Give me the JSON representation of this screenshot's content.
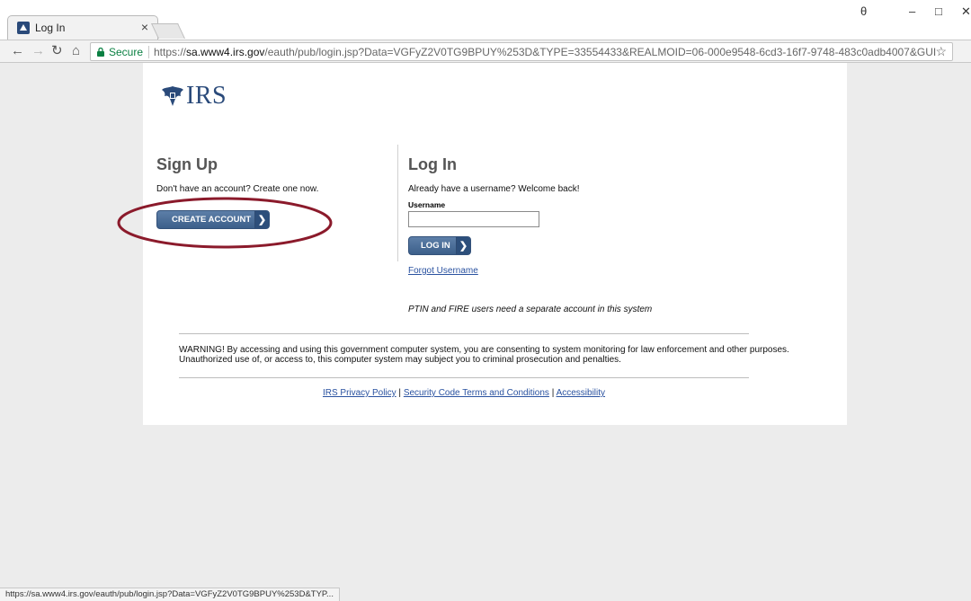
{
  "browser": {
    "tab_title": "Log In",
    "tab_close": "×",
    "window_buttons": {
      "profile": "θ",
      "minimize": "–",
      "maximize": "□",
      "close": "✕"
    },
    "secure_label": "Secure",
    "url_scheme": "https://",
    "url_host": "sa.www4.irs.gov",
    "url_rest": "/eauth/pub/login.jsp?Data=VGFyZ2V0TG9BPUY%253D&TYPE=33554433&REALMOID=06-000e9548-6cd3-16f7-9748-483c0adb4007&GUID=&SMAUTHR...",
    "icons": {
      "back": "arrow-left-icon",
      "forward": "arrow-right-icon",
      "reload": "reload-icon",
      "home": "home-icon",
      "lock": "lock-icon",
      "star": "star-icon"
    },
    "status_url": "https://sa.www4.irs.gov/eauth/pub/login.jsp?Data=VGFyZ2V0TG9BPUY%253D&TYP..."
  },
  "logo": {
    "text": "IRS",
    "icon": "irs-eagle-icon",
    "color": "#2a4a7a"
  },
  "signup": {
    "heading": "Sign Up",
    "text": "Don't have an account? Create one now.",
    "button_label": "CREATE ACCOUNT",
    "button_icon": "chevron-right-icon",
    "highlight_color": "#8b1a2b"
  },
  "login": {
    "heading": "Log In",
    "text": "Already have a username? Welcome back!",
    "username_label": "Username",
    "username_value": "",
    "button_label": "LOG IN",
    "button_icon": "chevron-right-icon",
    "forgot_link": "Forgot Username",
    "ptin_note": "PTIN and FIRE users need a separate account in this system"
  },
  "warning": "WARNING! By accessing and using this government computer system, you are consenting to system monitoring for law enforcement and other purposes. Unauthorized use of, or access to, this computer system may subject you to criminal prosecution and penalties.",
  "footer": {
    "links": [
      "IRS Privacy Policy",
      "Security Code Terms and Conditions",
      "Accessibility"
    ],
    "separator": "|"
  },
  "colors": {
    "button": "#3c5f8a",
    "link": "#2a52a0",
    "secure": "#0b8043"
  }
}
